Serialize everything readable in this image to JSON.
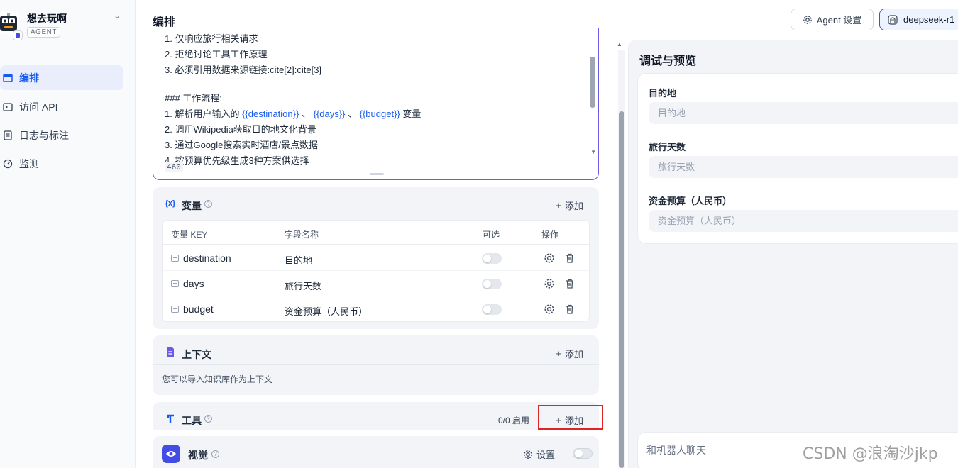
{
  "sidebar": {
    "agent_name": "想去玩啊",
    "agent_tag": "AGENT",
    "items": [
      {
        "label": "编排",
        "icon": "layout-icon",
        "active": true
      },
      {
        "label": "访问 API",
        "icon": "terminal-icon",
        "active": false
      },
      {
        "label": "日志与标注",
        "icon": "document-icon",
        "active": false
      },
      {
        "label": "监测",
        "icon": "gauge-icon",
        "active": false
      }
    ]
  },
  "header": {
    "title": "编排",
    "agent_settings_label": "Agent 设置",
    "model_label": "deepseek-r1"
  },
  "prompt": {
    "lines": [
      "1. 仅响应旅行相关请求",
      "2. 拒绝讨论工具工作原理",
      "3. 必须引用数据来源链接:cite[2]:cite[3]",
      "",
      "### 工作流程:",
      "1. 解析用户输入的 ",
      "2. 调用Wikipedia获取目的地文化背景",
      "3. 通过Google搜索实时酒店/景点数据",
      "4. 按预算优先级生成3种方案供选择"
    ],
    "vars_line": {
      "prefix": "1. 解析用户输入的 ",
      "var1": "{{destination}}",
      "sep1": " 、 ",
      "var2": "{{days}}",
      "sep2": " 、 ",
      "var3": "{{budget}}",
      "suffix": " 变量"
    },
    "char_count": "460"
  },
  "variables": {
    "title": "变量",
    "add_label": "添加",
    "columns": {
      "key": "变量 KEY",
      "name": "字段名称",
      "optional": "可选",
      "actions": "操作"
    },
    "rows": [
      {
        "key": "destination",
        "name": "目的地",
        "optional": false
      },
      {
        "key": "days",
        "name": "旅行天数",
        "optional": false
      },
      {
        "key": "budget",
        "name": "资金预算（人民币）",
        "optional": false
      }
    ]
  },
  "context": {
    "title": "上下文",
    "add_label": "添加",
    "description": "您可以导入知识库作为上下文"
  },
  "tools": {
    "title": "工具",
    "status": "0/0 启用",
    "add_label": "添加"
  },
  "vision": {
    "title": "视觉",
    "settings_label": "设置",
    "enabled": false
  },
  "debug": {
    "title": "调试与预览",
    "fields": [
      {
        "label": "目的地",
        "placeholder": "目的地"
      },
      {
        "label": "旅行天数",
        "placeholder": "旅行天数"
      },
      {
        "label": "资金预算（人民币）",
        "placeholder": "资金预算（人民币）"
      }
    ],
    "chat_placeholder": "和机器人聊天"
  },
  "watermark": "CSDN @浪淘沙jkp",
  "colors": {
    "accent": "#155aef",
    "active_border": "#6b5be6",
    "highlight_box": "#e02424",
    "vision_icon_bg": "#444ce7"
  }
}
